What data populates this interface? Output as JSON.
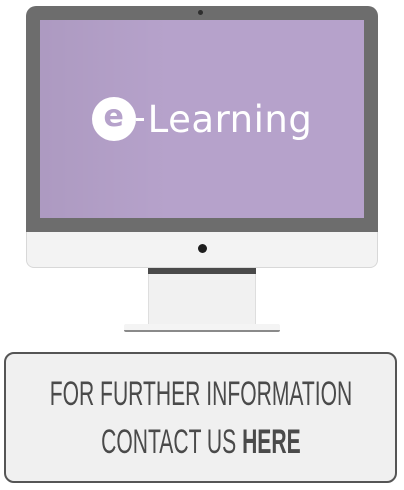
{
  "screen": {
    "logo_badge_letter": "e",
    "logo_word": "Learning"
  },
  "contact": {
    "line1": "FOR FURTHER INFORMATION",
    "line2_prefix": "CONTACT US ",
    "line2_link": "HERE"
  },
  "colors": {
    "screen": "#b6a2cb",
    "bezel": "#6d6d6d",
    "button_border": "#555555",
    "button_bg": "#f0f0f0",
    "button_text": "#4a4a4a"
  },
  "icons": [
    "camera-icon",
    "power-led-icon",
    "elearning-logo-icon"
  ]
}
